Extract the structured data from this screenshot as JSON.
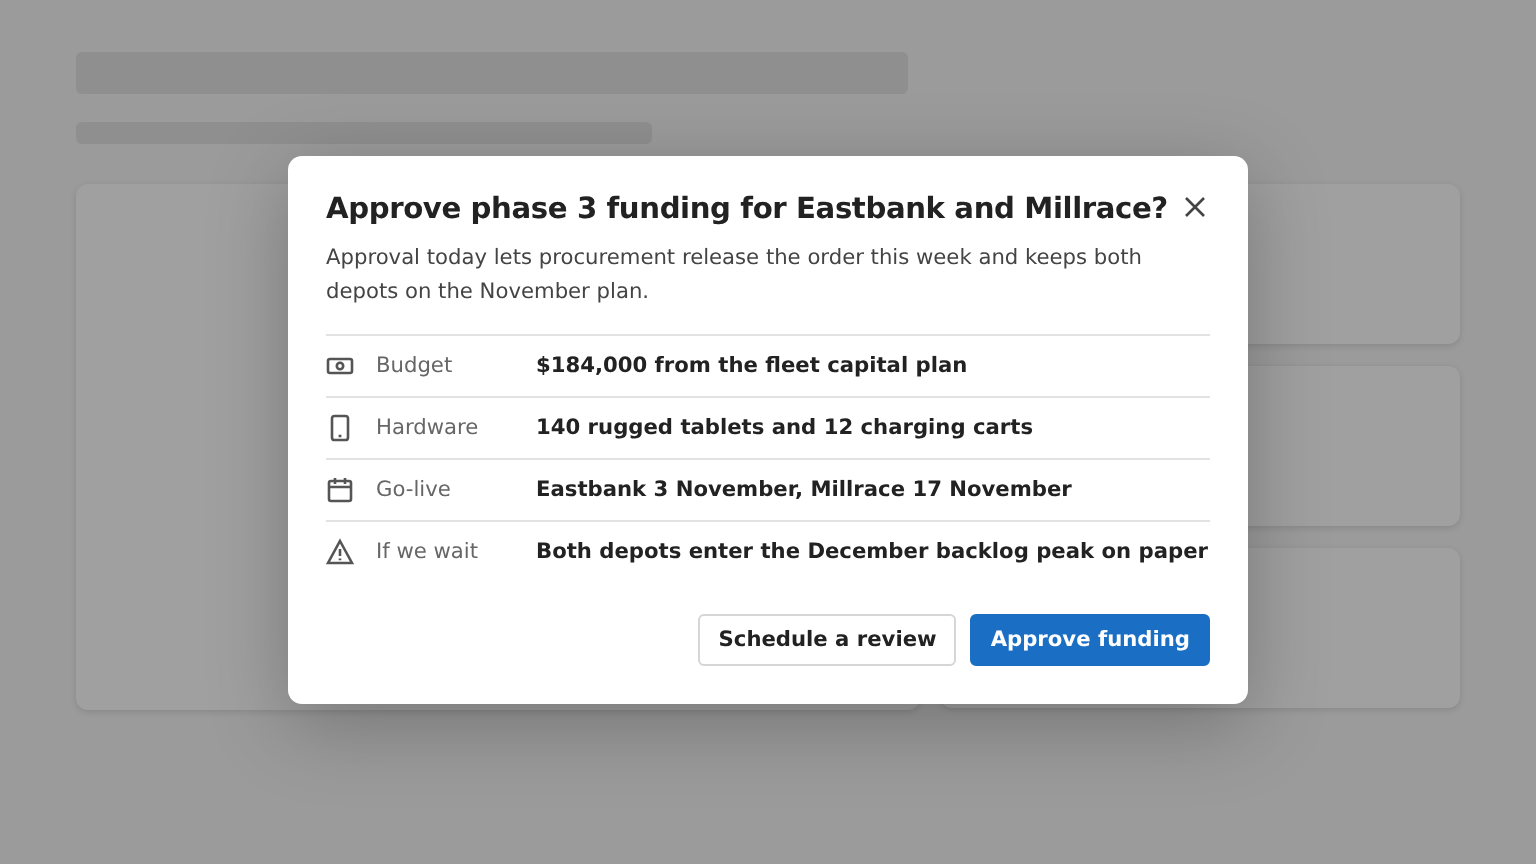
{
  "dialog": {
    "title": "Approve phase 3 funding for Eastbank and Millrace?",
    "description": "Approval today lets procurement release the order this week and keeps both depots on the November plan.",
    "details": [
      {
        "kind": "budget",
        "label": "Budget",
        "value": "$184,000 from the fleet capital plan"
      },
      {
        "kind": "hardware",
        "label": "Hardware",
        "value": "140 rugged tablets and 12 charging carts"
      },
      {
        "kind": "date",
        "label": "Go-live",
        "value": "Eastbank 3 November, Millrace 17 November"
      },
      {
        "kind": "risk",
        "label": "If we wait",
        "value": "Both depots enter the December backlog peak on paper"
      }
    ],
    "buttons": [
      {
        "kind": "secondary",
        "label": "Schedule a review"
      },
      {
        "kind": "primary",
        "label": "Approve funding"
      }
    ]
  }
}
